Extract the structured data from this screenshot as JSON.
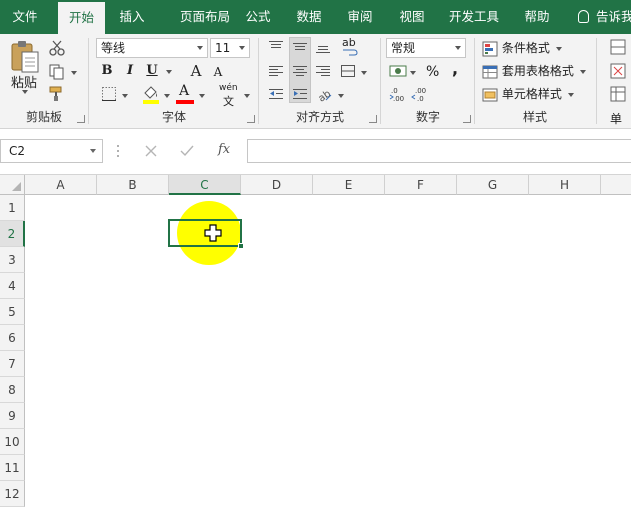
{
  "tabs": [
    {
      "label": "文件",
      "active": false
    },
    {
      "label": "开始",
      "active": true
    },
    {
      "label": "插入",
      "active": false
    },
    {
      "label": "页面布局",
      "active": false
    },
    {
      "label": "公式",
      "active": false
    },
    {
      "label": "数据",
      "active": false
    },
    {
      "label": "审阅",
      "active": false
    },
    {
      "label": "视图",
      "active": false
    },
    {
      "label": "开发工具",
      "active": false
    },
    {
      "label": "帮助",
      "active": false
    }
  ],
  "tell_me": "告诉我",
  "ribbon": {
    "clipboard": {
      "label": "剪贴板",
      "paste_label": "粘贴"
    },
    "font": {
      "label": "字体",
      "font_name": "等线",
      "font_size": "11",
      "bold": "B",
      "italic": "I",
      "underline": "U",
      "grow": "A",
      "shrink": "A",
      "font_color_letter": "A",
      "phonetic": "wén",
      "phonetic_char": "文",
      "highlight_color": "#ffff00",
      "font_color": "#ff0000"
    },
    "alignment": {
      "label": "对齐方式",
      "wrap_glyph": "ab"
    },
    "number": {
      "label": "数字",
      "format": "常规",
      "percent": "%",
      "comma": ","
    },
    "styles": {
      "label": "样式",
      "conditional": "条件格式",
      "table": "套用表格格式",
      "cell_styles": "单元格样式"
    },
    "cells": {
      "label": "单"
    }
  },
  "formula_bar": {
    "name_box": "C2",
    "fx": "fx",
    "formula": ""
  },
  "sheet": {
    "columns": [
      "A",
      "B",
      "C",
      "D",
      "E",
      "F",
      "G",
      "H"
    ],
    "rows": [
      "1",
      "2",
      "3",
      "4",
      "5",
      "6",
      "7",
      "8",
      "9",
      "10",
      "11",
      "12"
    ],
    "selected_cell": "C2",
    "accent": "#217346"
  }
}
